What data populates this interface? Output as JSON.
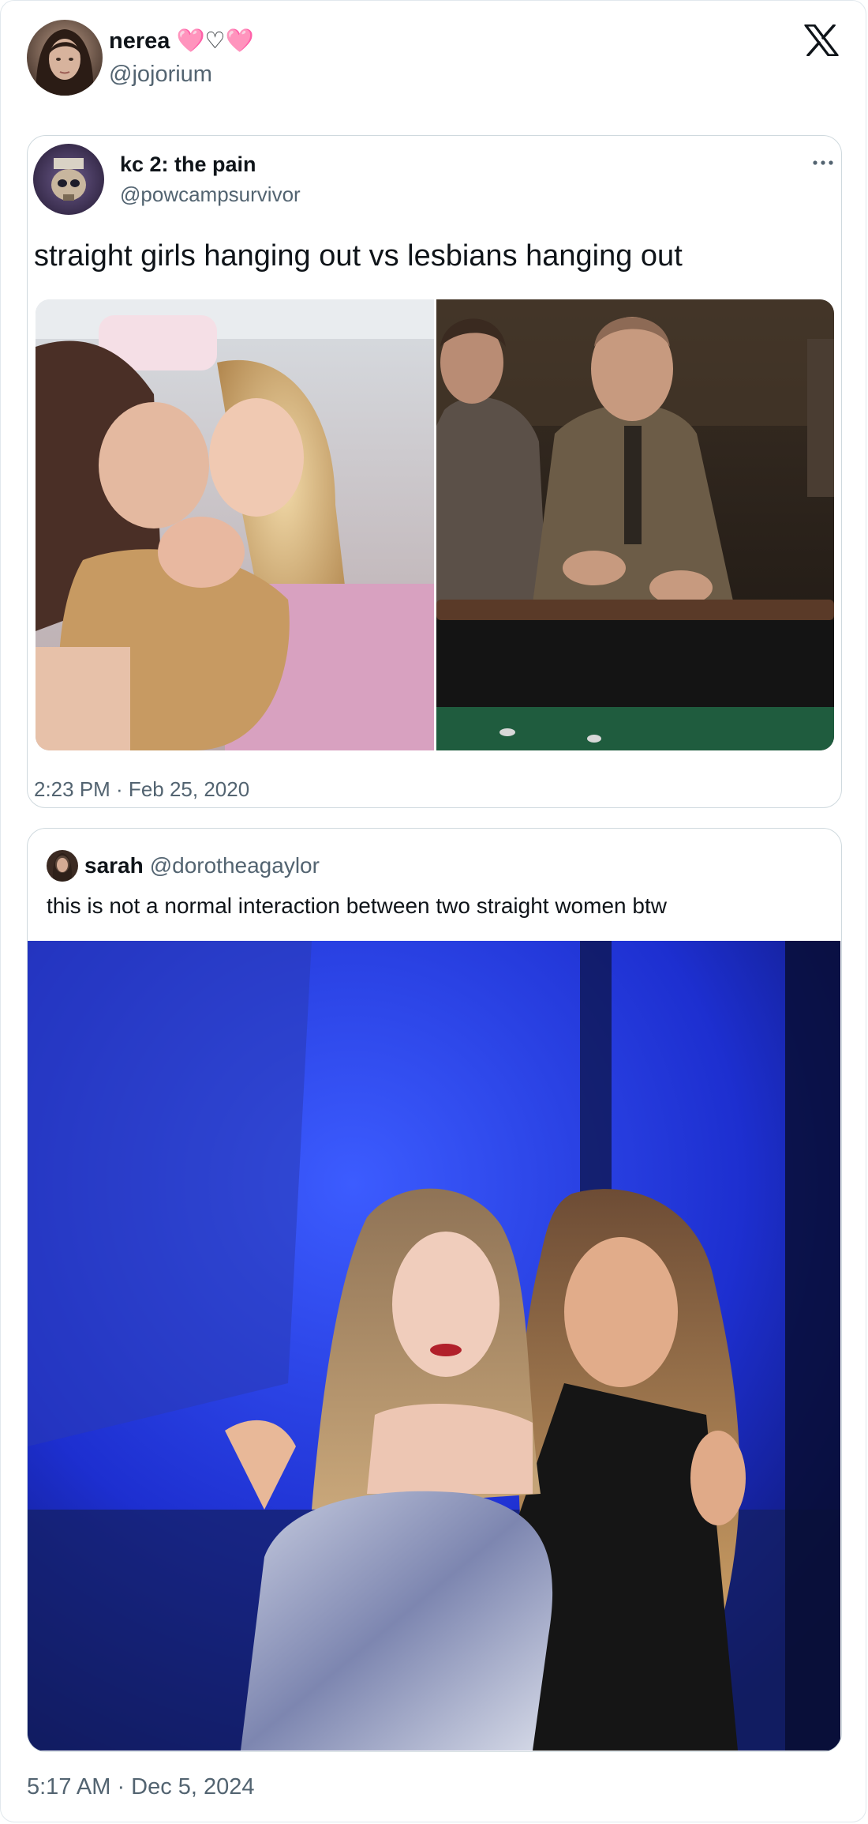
{
  "post": {
    "author": {
      "display_name": "nerea 🩷♡🩷",
      "handle": "@jojorium",
      "avatar_icon": "user-avatar"
    },
    "platform_icon": "x-logo-icon",
    "timestamp": "5:17 AM · Dec 5, 2024"
  },
  "quote_1": {
    "author": {
      "display_name": "kc 2: the pain",
      "handle": "@powcampsurvivor",
      "avatar_icon": "user-avatar"
    },
    "more_icon": "more-dots-icon",
    "text": "straight girls hanging out vs lesbians hanging out",
    "media": [
      {
        "name": "photo-left",
        "kind": "photo"
      },
      {
        "name": "photo-right",
        "kind": "photo"
      }
    ],
    "timestamp": "2:23 PM · Feb 25, 2020"
  },
  "quote_2": {
    "author": {
      "display_name": "sarah",
      "handle": "@dorotheagaylor",
      "avatar_icon": "user-avatar"
    },
    "text": "this is not a normal interaction between two straight women btw",
    "media": [
      {
        "name": "photo",
        "kind": "photo"
      }
    ]
  },
  "colors": {
    "text_primary": "#0f1419",
    "text_secondary": "#536471",
    "border": "#cfd9de",
    "photo2_background": "#1d2fd0"
  }
}
